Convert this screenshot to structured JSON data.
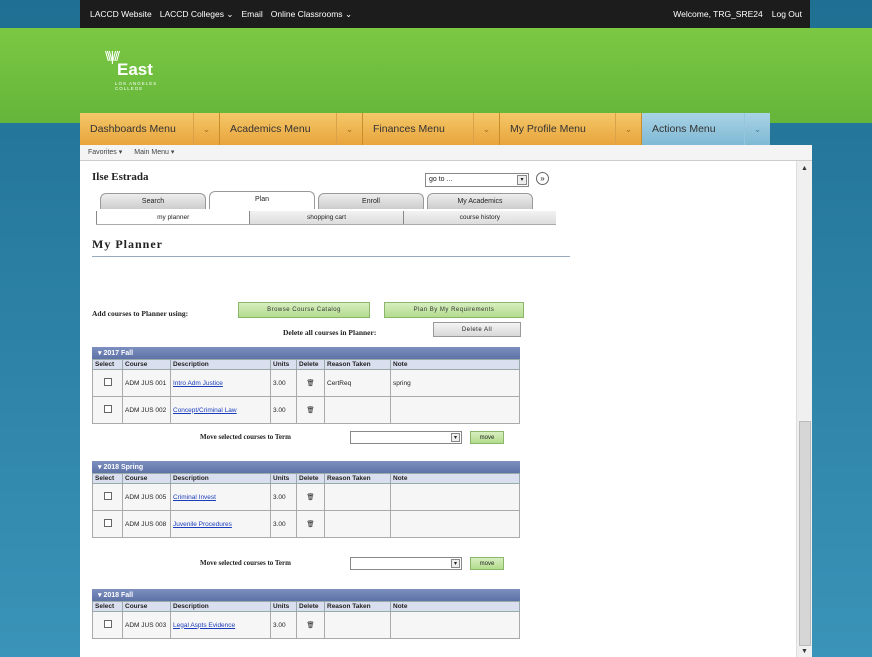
{
  "topbar": {
    "links": [
      "LACCD Website",
      "LACCD Colleges",
      "Email",
      "Online Classrooms"
    ],
    "welcome": "Welcome, TRG_SRE24",
    "logout": "Log Out"
  },
  "logo": {
    "name": "East",
    "sub": "LOS ANGELES COLLEGE"
  },
  "nav": [
    {
      "label": "Dashboards Menu"
    },
    {
      "label": "Academics Menu"
    },
    {
      "label": "Finances Menu"
    },
    {
      "label": "My Profile Menu"
    },
    {
      "label": "Actions Menu"
    }
  ],
  "favbar": {
    "favorites": "Favorites ▾",
    "main_menu": "Main Menu ▾"
  },
  "student_name": "Ilse Estrada",
  "goto": {
    "value": "go to ..."
  },
  "tabs": [
    "Search",
    "Plan",
    "Enroll",
    "My Academics"
  ],
  "subtabs": [
    "my planner",
    "shopping cart",
    "course history"
  ],
  "page_title": "My Planner",
  "add_label": "Add courses to Planner using:",
  "browse_btn": "Browse Course Catalog",
  "plan_btn": "Plan By My Requirements",
  "delete_all_label": "Delete all courses in Planner:",
  "delete_all_btn": "Delete All",
  "columns": [
    "Select",
    "Course",
    "Description",
    "Units",
    "Delete",
    "Reason Taken",
    "Note"
  ],
  "move_label": "Move selected courses to Term",
  "move_btn": "move",
  "terms": [
    {
      "name": "2017 Fall",
      "rows": [
        {
          "course": "ADM JUS 001",
          "desc": "Intro Adm Justice",
          "units": "3.00",
          "reason": "CertReq",
          "note": "spring"
        },
        {
          "course": "ADM JUS 002",
          "desc": "Concept/Criminal Law",
          "units": "3.00",
          "reason": "",
          "note": ""
        }
      ]
    },
    {
      "name": "2018 Spring",
      "rows": [
        {
          "course": "ADM JUS 005",
          "desc": "Criminal Invest",
          "units": "3.00",
          "reason": "",
          "note": ""
        },
        {
          "course": "ADM JUS 008",
          "desc": "Juvenile Procedures",
          "units": "3.00",
          "reason": "",
          "note": ""
        }
      ]
    },
    {
      "name": "2018 Fall",
      "rows": [
        {
          "course": "ADM JUS 003",
          "desc": "Legal Aspts Evidence",
          "units": "3.00",
          "reason": "",
          "note": ""
        }
      ]
    }
  ]
}
